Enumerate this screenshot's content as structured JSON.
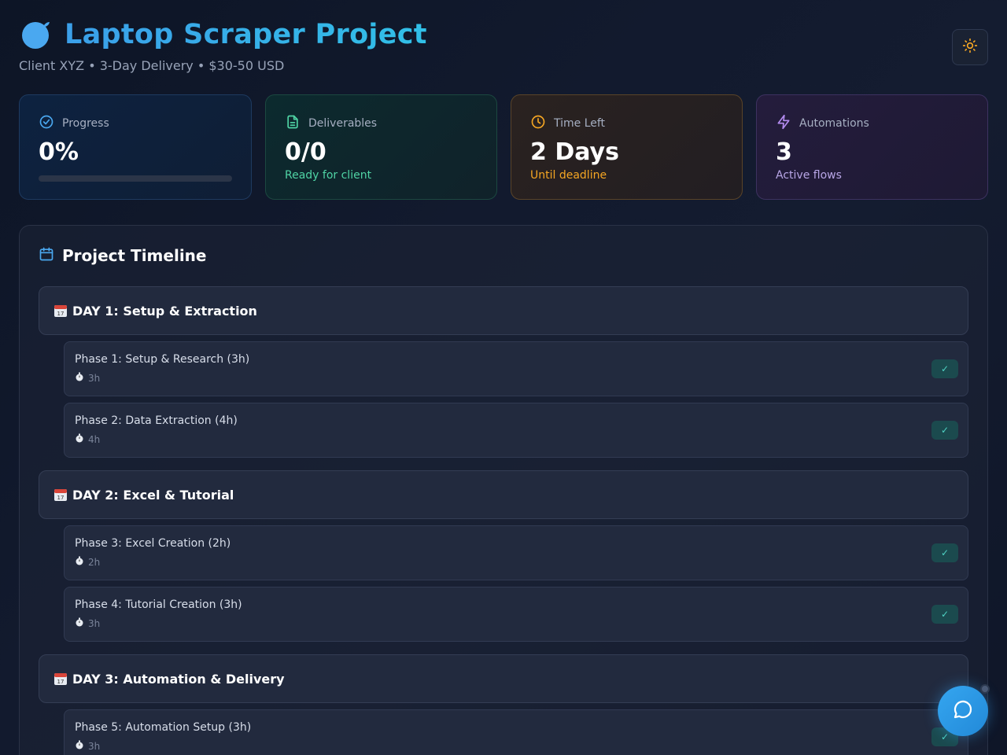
{
  "header": {
    "title": "Laptop Scraper Project",
    "subtitle": "Client XYZ • 3-Day Delivery • $30-50 USD",
    "icons": {
      "logo": "apple-logo-icon",
      "theme": "sun-icon"
    }
  },
  "stats": {
    "progress": {
      "label": "Progress",
      "value": "0%",
      "fraction": 0,
      "icon": "check-circle-icon"
    },
    "deliverables": {
      "label": "Deliverables",
      "value": "0/0",
      "sub": "Ready for client",
      "icon": "document-icon"
    },
    "time_left": {
      "label": "Time Left",
      "value": "2 Days",
      "sub": "Until deadline",
      "icon": "clock-icon"
    },
    "automations": {
      "label": "Automations",
      "value": "3",
      "sub": "Active flows",
      "icon": "lightning-icon"
    }
  },
  "timeline": {
    "title": "Project Timeline",
    "icon": "calendar-icon",
    "days": [
      {
        "label": "DAY 1: Setup & Extraction",
        "phases": [
          {
            "name": "Phase 1: Setup & Research (3h)",
            "duration": "3h",
            "done_label": "✓"
          },
          {
            "name": "Phase 2: Data Extraction (4h)",
            "duration": "4h",
            "done_label": "✓"
          }
        ]
      },
      {
        "label": "DAY 2: Excel & Tutorial",
        "phases": [
          {
            "name": "Phase 3: Excel Creation (2h)",
            "duration": "2h",
            "done_label": "✓"
          },
          {
            "name": "Phase 4: Tutorial Creation (3h)",
            "duration": "3h",
            "done_label": "✓"
          }
        ]
      },
      {
        "label": "DAY 3: Automation & Delivery",
        "phases": [
          {
            "name": "Phase 5: Automation Setup (3h)",
            "duration": "3h",
            "done_label": "✓"
          }
        ]
      }
    ]
  },
  "colors": {
    "accent": "#3b9fe9",
    "green": "#4fd3a4",
    "orange": "#f5a623",
    "purple": "#b48cf0"
  },
  "chat": {
    "icon": "chat-bubble-icon"
  }
}
